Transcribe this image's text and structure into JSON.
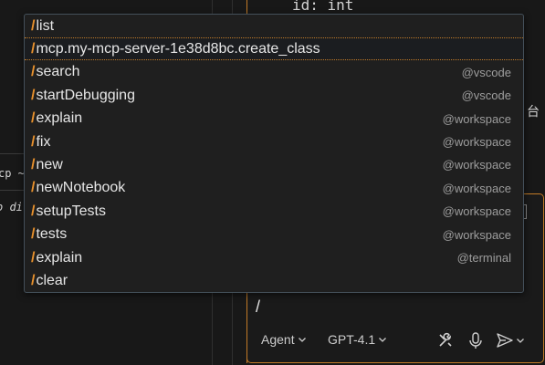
{
  "background": {
    "code_line": "id: int",
    "left_fragment_1": "cp ~",
    "left_fragment_2": "o di",
    "edge_glyph": "台"
  },
  "chat": {
    "input_value": "/",
    "mode_label": "Agent",
    "model_label": "GPT-4.1"
  },
  "popup": {
    "items": [
      {
        "command": "list",
        "scope": ""
      },
      {
        "command": "mcp.my-mcp-server-1e38d8bc.create_class",
        "scope": ""
      },
      {
        "command": "search",
        "scope": "@vscode"
      },
      {
        "command": "startDebugging",
        "scope": "@vscode"
      },
      {
        "command": "explain",
        "scope": "@workspace"
      },
      {
        "command": "fix",
        "scope": "@workspace"
      },
      {
        "command": "new",
        "scope": "@workspace"
      },
      {
        "command": "newNotebook",
        "scope": "@workspace"
      },
      {
        "command": "setupTests",
        "scope": "@workspace"
      },
      {
        "command": "tests",
        "scope": "@workspace"
      },
      {
        "command": "explain",
        "scope": "@terminal"
      },
      {
        "command": "clear",
        "scope": ""
      }
    ],
    "selected_index": 1,
    "slash_symbol": "/"
  },
  "colors": {
    "accent_orange": "#e8912d",
    "border_orange": "#c27b27",
    "popup_bg": "#1f1f1f",
    "text": "#e6e6e6",
    "muted": "#9d9d9d"
  }
}
